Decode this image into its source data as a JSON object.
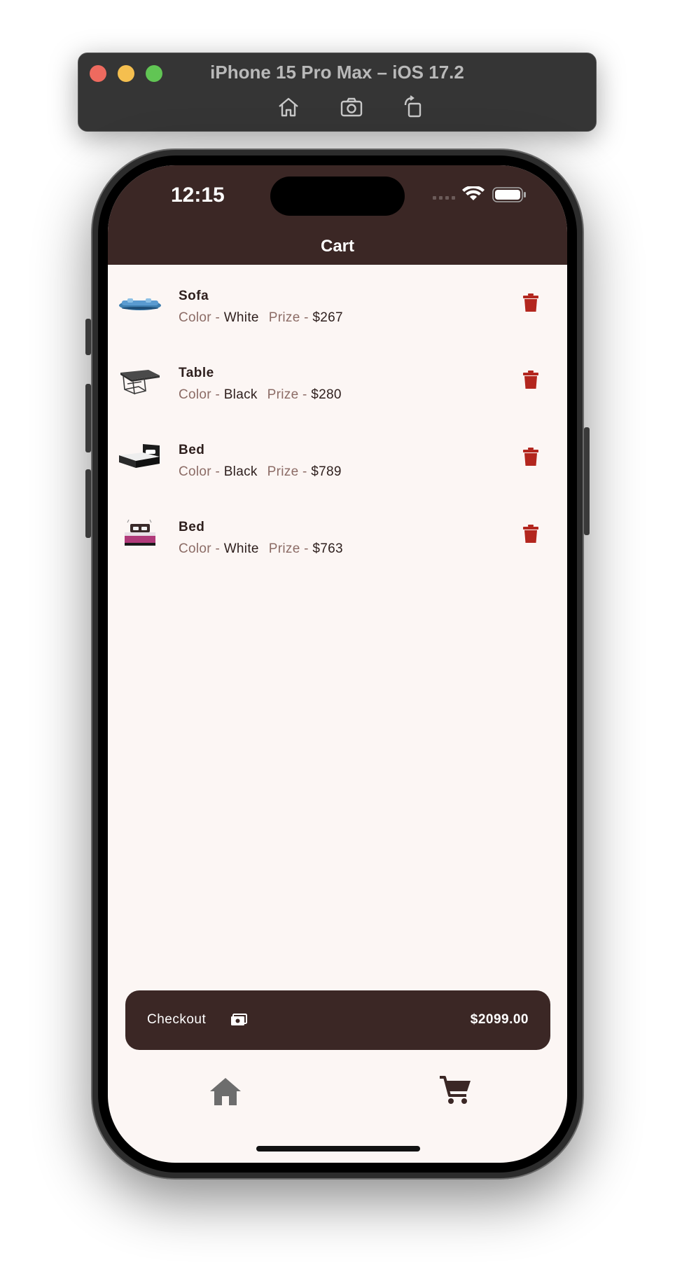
{
  "simulator": {
    "title": "iPhone 15 Pro Max – iOS 17.2",
    "tools": [
      "home-icon",
      "screenshot-icon",
      "rotate-icon"
    ]
  },
  "status_bar": {
    "time": "12:15"
  },
  "appbar": {
    "title": "Cart"
  },
  "cart": {
    "labels": {
      "color": "Color - ",
      "prize": "Prize - "
    },
    "items": [
      {
        "name": "Sofa",
        "color": "White",
        "prize": "$267",
        "thumb": "sofa-thumbnail"
      },
      {
        "name": "Table",
        "color": "Black",
        "prize": "$280",
        "thumb": "table-thumbnail"
      },
      {
        "name": "Bed",
        "color": "Black",
        "prize": "$789",
        "thumb": "bed-black-thumbnail"
      },
      {
        "name": "Bed",
        "color": "White",
        "prize": "$763",
        "thumb": "bed-white-thumbnail"
      }
    ]
  },
  "checkout": {
    "label": "Checkout",
    "total": "$2099.00"
  },
  "bottom_nav": {
    "items": [
      "home-icon",
      "cart-icon"
    ]
  },
  "colors": {
    "primary": "#3b2725",
    "background": "#fcf6f4",
    "delete": "#b3261e",
    "muted_text": "#8c6c66"
  }
}
